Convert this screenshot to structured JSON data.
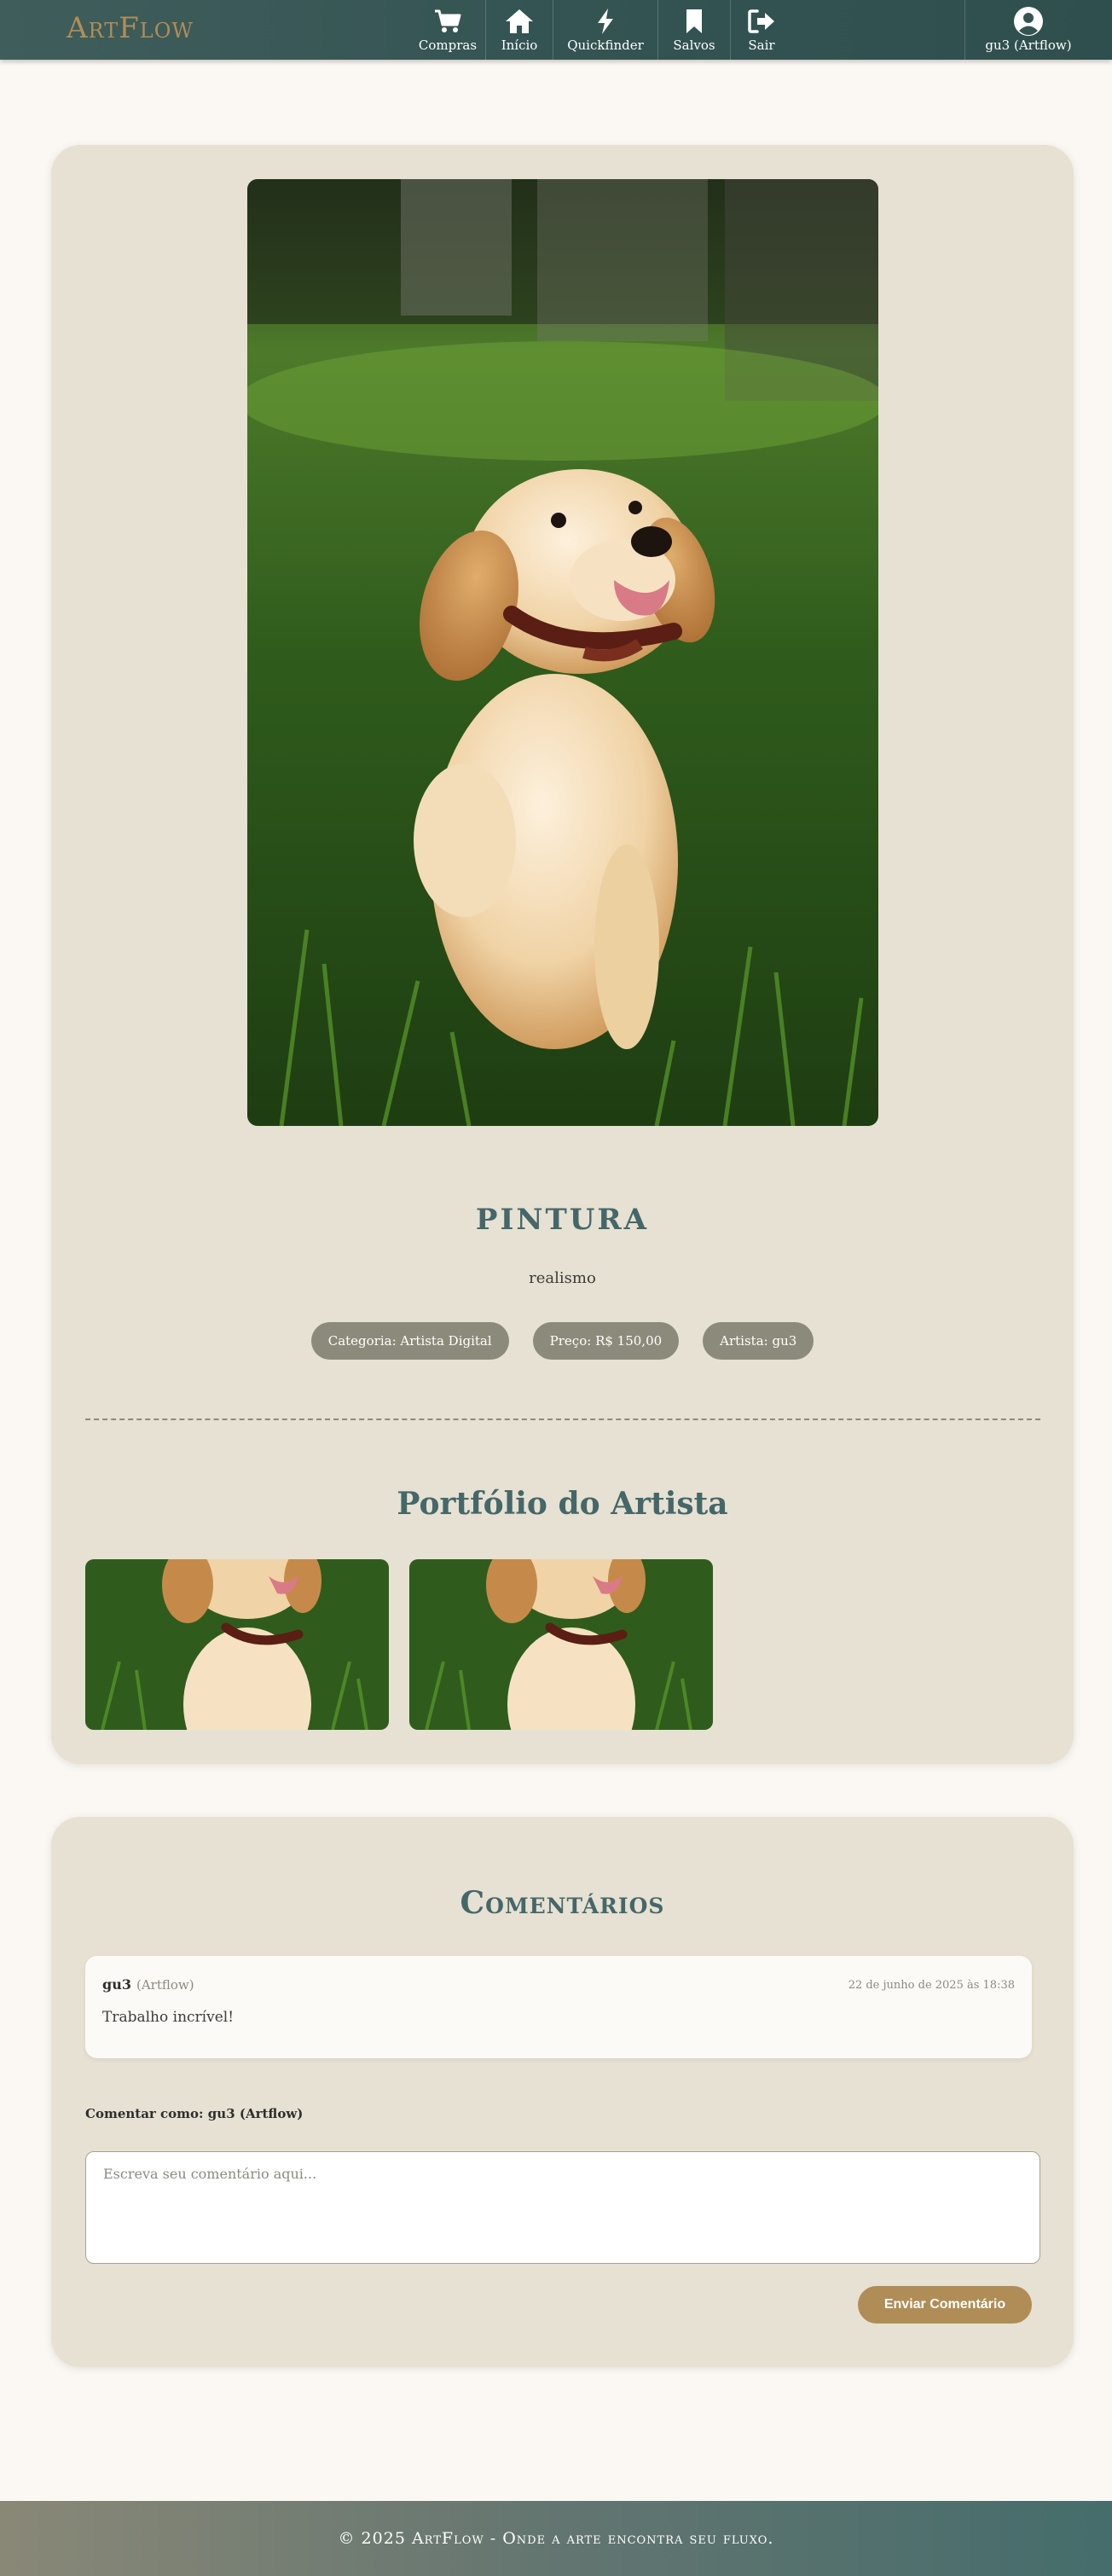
{
  "brand": {
    "logo_text": "ArtFlow"
  },
  "nav": {
    "items": [
      {
        "label": "Compras",
        "icon": "cart-icon"
      },
      {
        "label": "Início",
        "icon": "home-icon"
      },
      {
        "label": "Quickfinder",
        "icon": "bolt-icon"
      },
      {
        "label": "Salvos",
        "icon": "bookmark-icon"
      },
      {
        "label": "Sair",
        "icon": "logout-icon"
      }
    ],
    "user": {
      "label": "gu3 (Artflow)",
      "icon": "user-circle-icon"
    }
  },
  "artwork": {
    "title": "PINTURA",
    "description": "realismo",
    "badges": {
      "category": "Categoria: Artista Digital",
      "price": "Preço: R$ 150,00",
      "artist": "Artista: gu3"
    }
  },
  "portfolio": {
    "title": "Portfólio do Artista"
  },
  "comments": {
    "title": "Comentários",
    "items": [
      {
        "author": "gu3",
        "org": "(Artflow)",
        "date": "22 de junho de 2025 às 18:38",
        "text": "Trabalho incrível!"
      }
    ],
    "comment_as": "Comentar como: gu3 (Artflow)",
    "placeholder": "Escreva seu comentário aqui...",
    "submit_label": "Enviar Comentário"
  },
  "footer": {
    "text": "© 2025 ArtFlow - Onde a arte encontra seu fluxo."
  },
  "colors": {
    "accent_gold": "#b08d57",
    "teal": "#45676a",
    "card_bg": "#e6e1d2",
    "badge_bg": "#8c8b7b"
  }
}
